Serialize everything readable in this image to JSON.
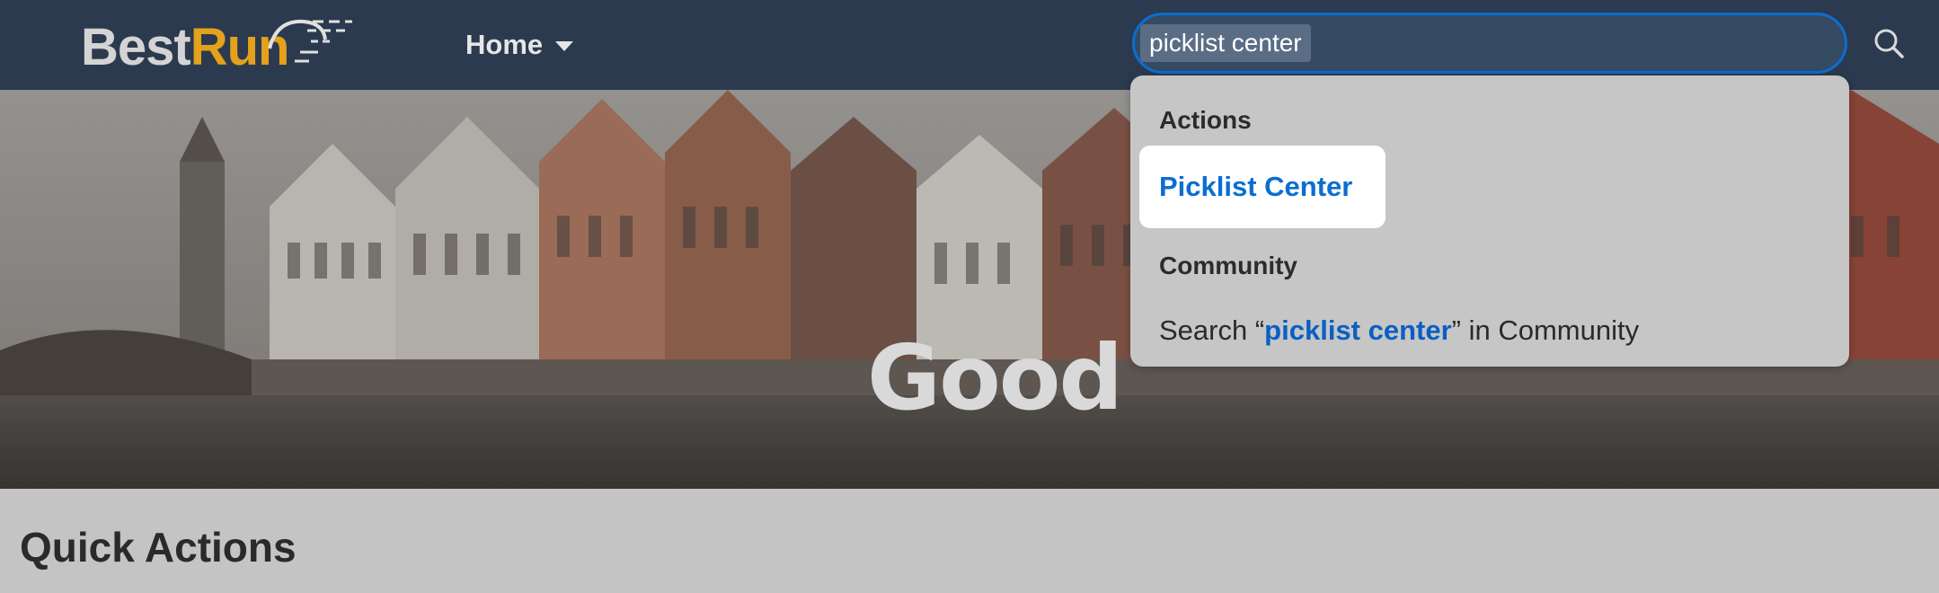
{
  "header": {
    "logo": {
      "part1": "Best",
      "part2": "Run"
    },
    "home_menu": {
      "label": "Home"
    },
    "search": {
      "value": "picklist center",
      "icon": "search-icon"
    }
  },
  "hero": {
    "greeting": "Good"
  },
  "suggestions": {
    "actions_header": "Actions",
    "actions_items": [
      {
        "label": "Picklist Center"
      }
    ],
    "community_header": "Community",
    "community_item": {
      "prefix": "Search “",
      "term": "picklist center",
      "suffix": "” in Community"
    }
  },
  "main": {
    "section_title": "Quick Actions"
  },
  "colors": {
    "shellbar": "#2b3a4f",
    "accent": "#0a6ed1",
    "logo_run": "#e4a11b",
    "popover": "#c6c6c6"
  }
}
